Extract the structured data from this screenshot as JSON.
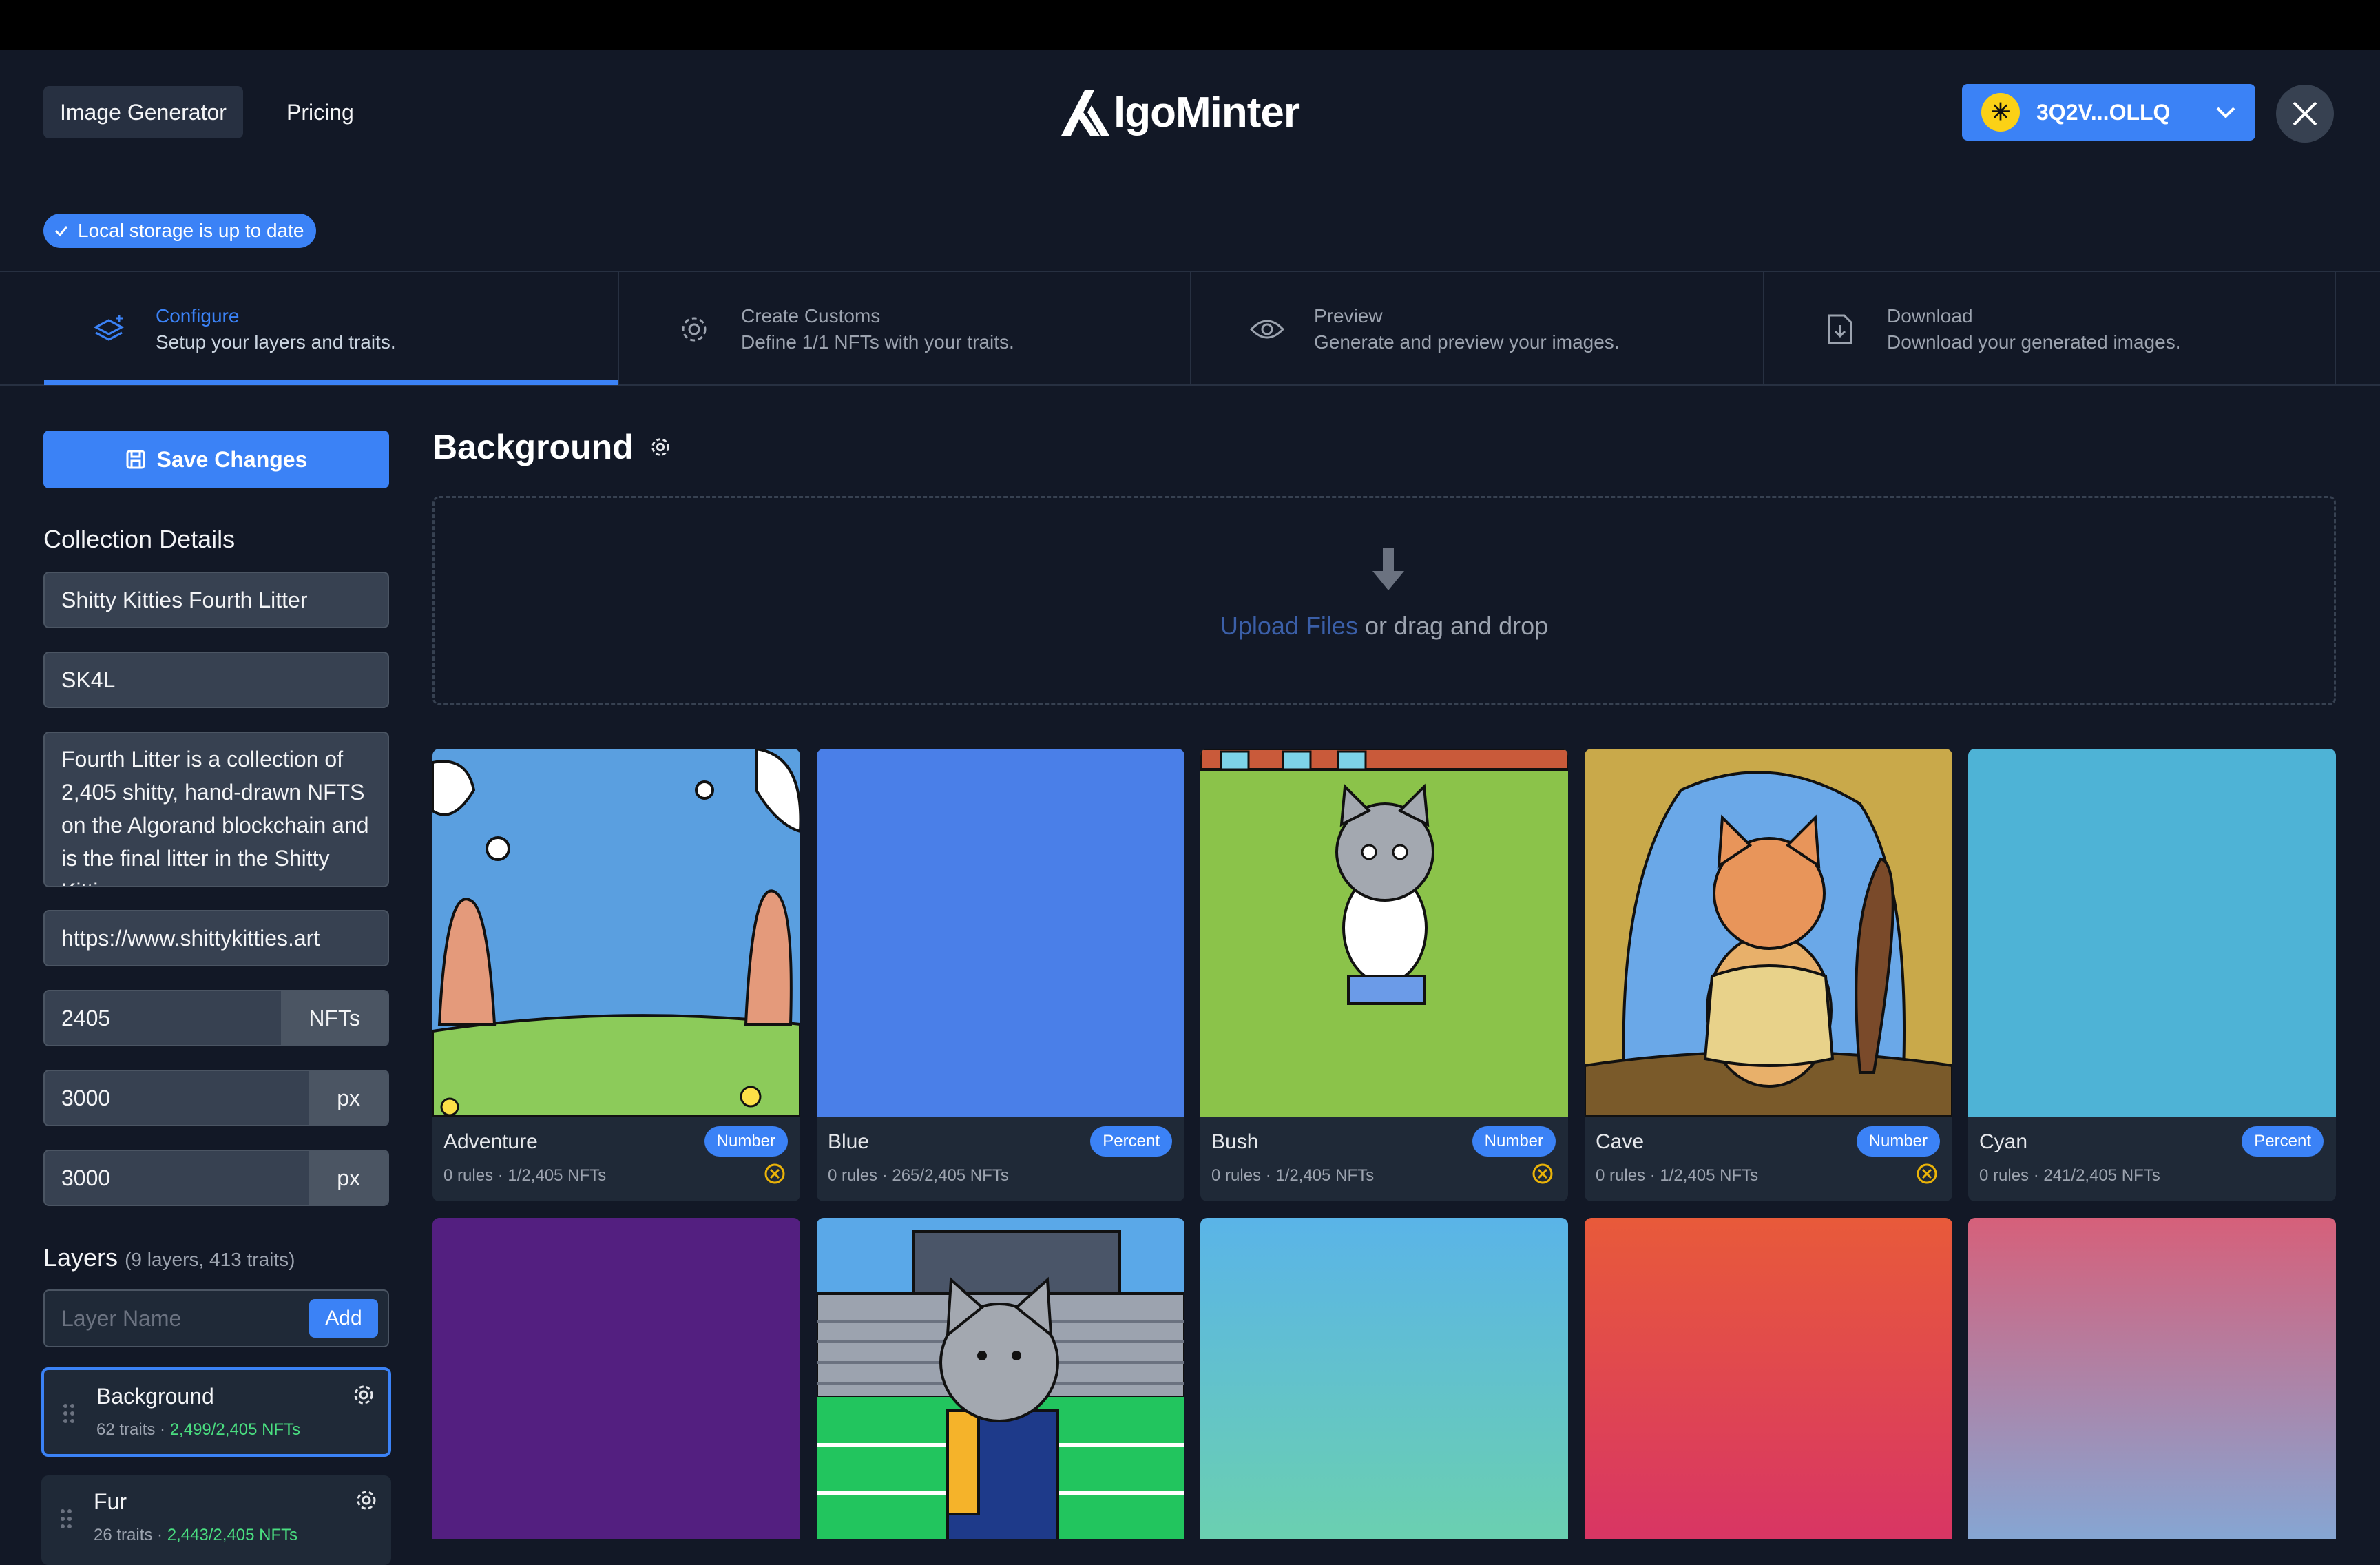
{
  "header": {
    "nav": [
      {
        "label": "Image Generator",
        "active": true
      },
      {
        "label": "Pricing",
        "active": false
      }
    ],
    "logo_text": "lgoMinter",
    "wallet": {
      "address": "3Q2V...OLLQ"
    }
  },
  "storage_status": "Local storage is up to date",
  "steps": [
    {
      "title": "Configure",
      "desc": "Setup your layers and traits.",
      "icon": "layers-icon",
      "active": true
    },
    {
      "title": "Create Customs",
      "desc": "Define 1/1 NFTs with your traits.",
      "icon": "gear-icon",
      "active": false
    },
    {
      "title": "Preview",
      "desc": "Generate and preview your images.",
      "icon": "eye-icon",
      "active": false
    },
    {
      "title": "Download",
      "desc": "Download your generated images.",
      "icon": "download-icon",
      "active": false
    }
  ],
  "sidebar": {
    "save_label": "Save Changes",
    "collection_heading": "Collection Details",
    "collection_name": "Shitty Kitties Fourth Litter",
    "unit_name": "SK4L",
    "description": "Fourth Litter is a collection of 2,405 shitty, hand-drawn NFTS on the Algorand blockchain and is the final litter in the Shitty Kitties",
    "url": "https://www.shittykitties.art",
    "count": "2405",
    "count_suffix": "NFTs",
    "width": "3000",
    "height": "3000",
    "px_suffix": "px",
    "layers_heading": "Layers",
    "layers_summary": "(9 layers, 413 traits)",
    "layer_placeholder": "Layer Name",
    "add_label": "Add",
    "layers": [
      {
        "name": "Background",
        "traits": "62 traits · ",
        "nfts": "2,499/2,405 NFTs",
        "selected": true
      },
      {
        "name": "Fur",
        "traits": "26 traits · ",
        "nfts": "2,443/2,405 NFTs",
        "selected": false
      }
    ]
  },
  "main": {
    "title": "Background",
    "upload_link": "Upload Files",
    "upload_rest": " or drag and drop",
    "traits": [
      {
        "name": "Adventure",
        "badge": "Number",
        "meta": "0 rules · 1/2,405 NFTs",
        "remove": true
      },
      {
        "name": "Blue",
        "badge": "Percent",
        "meta": "0 rules · 265/2,405 NFTs",
        "remove": false,
        "color": "#4a7fe8"
      },
      {
        "name": "Bush",
        "badge": "Number",
        "meta": "0 rules · 1/2,405 NFTs",
        "remove": true
      },
      {
        "name": "Cave",
        "badge": "Number",
        "meta": "0 rules · 1/2,405 NFTs",
        "remove": true
      },
      {
        "name": "Cyan",
        "badge": "Percent",
        "meta": "0 rules · 241/2,405 NFTs",
        "remove": false,
        "color": "#4eb3d6"
      }
    ]
  },
  "colors": {
    "accent": "#3b82f6",
    "bg": "#121826",
    "card": "#1f2937",
    "success": "#4ade80"
  }
}
